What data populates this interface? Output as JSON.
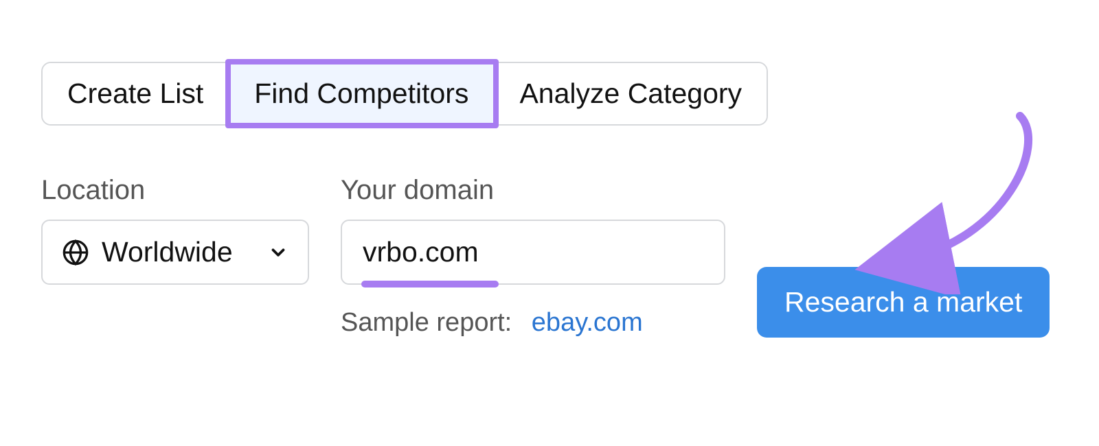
{
  "tabs": {
    "items": [
      {
        "label": "Create List"
      },
      {
        "label": "Find Competitors"
      },
      {
        "label": "Analyze Category"
      }
    ],
    "active_index": 1
  },
  "form": {
    "location": {
      "label": "Location",
      "value": "Worldwide"
    },
    "domain": {
      "label": "Your domain",
      "value": "vrbo.com"
    },
    "sample": {
      "label": "Sample report:",
      "link_text": "ebay.com"
    },
    "submit": {
      "label": "Research a market"
    }
  },
  "colors": {
    "tab_active_bg": "#eff5ff",
    "annotation_purple": "#a77cf1",
    "primary_button": "#3b8eea",
    "link": "#2a75d1",
    "border": "#d6d8db"
  }
}
